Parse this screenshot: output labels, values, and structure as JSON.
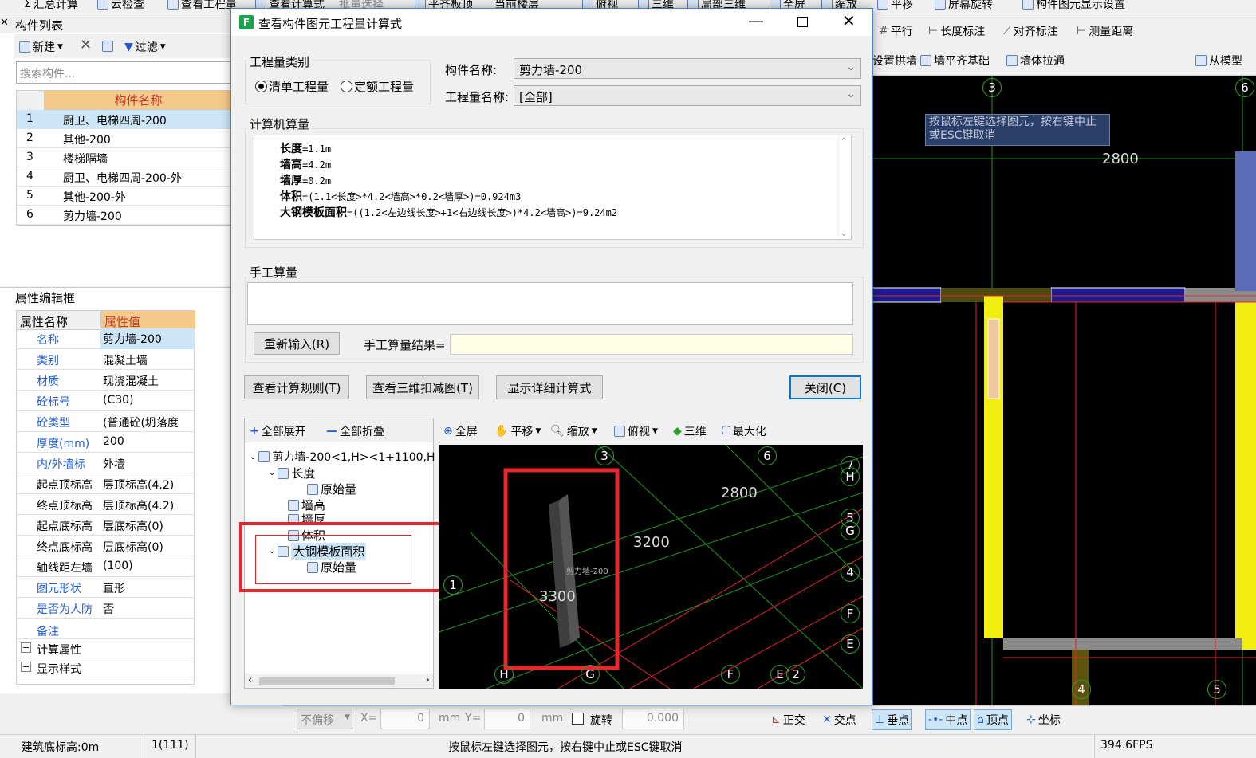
{
  "top_toolbar": {
    "items": [
      "汇总计算",
      "云检查",
      "查看工程量",
      "查看计算式",
      "批量选择",
      "平齐板顶",
      "当前楼层",
      "俯视",
      "三维",
      "局部三维",
      "全屏",
      "缩放",
      "平移",
      "屏幕旋转",
      "构件图元显示设置"
    ]
  },
  "component_list": {
    "title": "构件列表",
    "new_label": "新建",
    "filter_label": "过滤",
    "search_placeholder": "搜索构件...",
    "col_header": "构件名称",
    "rows": [
      {
        "no": "1",
        "name": "厨卫、电梯四周-200"
      },
      {
        "no": "2",
        "name": "其他-200"
      },
      {
        "no": "3",
        "name": "楼梯隔墙"
      },
      {
        "no": "4",
        "name": "厨卫、电梯四周-200-外"
      },
      {
        "no": "5",
        "name": "其他-200-外"
      },
      {
        "no": "6",
        "name": "剪力墙-200"
      }
    ]
  },
  "property_editor": {
    "title": "属性编辑框",
    "col_name": "属性名称",
    "col_value": "属性值",
    "rows": [
      {
        "name": "名称",
        "value": "剪力墙-200"
      },
      {
        "name": "类别",
        "value": "混凝土墙"
      },
      {
        "name": "材质",
        "value": "现浇混凝土"
      },
      {
        "name": "砼标号",
        "value": "(C30)"
      },
      {
        "name": "砼类型",
        "value": "(普通砼(坍落度"
      },
      {
        "name": "厚度(mm)",
        "value": "200"
      },
      {
        "name": "内/外墙标",
        "value": "外墙"
      },
      {
        "name": "起点顶标高",
        "value": "层顶标高(4.2)"
      },
      {
        "name": "终点顶标高",
        "value": "层顶标高(4.2)"
      },
      {
        "name": "起点底标高",
        "value": "层底标高(0)"
      },
      {
        "name": "终点底标高",
        "value": "层底标高(0)"
      },
      {
        "name": "轴线距左墙",
        "value": "(100)"
      },
      {
        "name": "图元形状",
        "value": "直形"
      },
      {
        "name": "是否为人防",
        "value": "否"
      },
      {
        "name": "备注",
        "value": ""
      },
      {
        "name": "计算属性",
        "value": ""
      },
      {
        "name": "显示样式",
        "value": ""
      }
    ]
  },
  "right_toolbar": {
    "row1": [
      "平行",
      "长度标注",
      "对齐标注",
      "测量距离"
    ],
    "row2": [
      "设置拱墙",
      "墙平齐基础",
      "墙体拉通",
      "从模型"
    ]
  },
  "cad_main": {
    "hint": "按鼠标左键选择图元，按右键中止或ESC键取消",
    "dim": "2800",
    "axes": [
      "3",
      "6",
      "4",
      "5"
    ]
  },
  "dialog": {
    "title": "查看构件图元工程量计算式",
    "qty_type_legend": "工程量类别",
    "radio_list": "清单工程量",
    "radio_quota": "定额工程量",
    "component_name_label": "构件名称:",
    "component_name_value": "剪力墙-200",
    "qty_name_label": "工程量名称:",
    "qty_name_value": "[全部]",
    "computer_qty_legend": "计算机算量",
    "formula": [
      {
        "k": "长度",
        "v": "=1.1m"
      },
      {
        "k": "墙高",
        "v": "=4.2m"
      },
      {
        "k": "墙厚",
        "v": "=0.2m"
      },
      {
        "k": "体积",
        "v": "=(1.1<长度>*4.2<墙高>*0.2<墙厚>)=0.924m3"
      },
      {
        "k": "大钢模板面积",
        "v": "=((1.2<左边线长度>+1<右边线长度>)*4.2<墙高>)=9.24m2"
      }
    ],
    "manual_legend": "手工算量",
    "reinput_btn": "重新输入(R)",
    "manual_result_label": "手工算量结果=",
    "btn_rules": "查看计算规则(T)",
    "btn_3d": "查看三维扣减图(T)",
    "btn_detail": "显示详细计算式",
    "btn_close": "关闭(C)",
    "tree_expand": "全部展开",
    "tree_collapse": "全部折叠",
    "tree": [
      {
        "label": "剪力墙-200<1,H><1+1100,H",
        "level": 0
      },
      {
        "label": "长度",
        "level": 1
      },
      {
        "label": "原始量",
        "level": 2
      },
      {
        "label": "墙高",
        "level": 1
      },
      {
        "label": "墙厚",
        "level": 1
      },
      {
        "label": "体积",
        "level": 1
      },
      {
        "label": "大钢模板面积",
        "level": 1
      },
      {
        "label": "原始量",
        "level": 2
      }
    ],
    "view_toolbar": [
      "全屏",
      "平移",
      "缩放",
      "俯视",
      "三维",
      "最大化"
    ],
    "preview_labels": {
      "d2800": "2800",
      "d3200": "3200",
      "d3300": "3300",
      "wall": "剪力墙-200",
      "axes": [
        "3",
        "6",
        "7",
        "H",
        "5",
        "G",
        "4",
        "F",
        "E",
        "2",
        "1",
        "H",
        "G",
        "F",
        "E"
      ]
    }
  },
  "bottom_bar": {
    "offset": "不偏移",
    "x_label": "X=",
    "x_value": "0",
    "mm1": "mm",
    "y_label": "Y=",
    "y_value": "0",
    "mm2": "mm",
    "rotate_label": "旋转",
    "rotate_value": "0.000",
    "snap": [
      "正交",
      "交点",
      "垂点",
      "中点",
      "顶点",
      "坐标"
    ]
  },
  "status_bar": {
    "elev": "建筑底标高:0m",
    "count": "1(111)",
    "hint": "按鼠标左键选择图元，按右键中止或ESC键取消",
    "fps": "394.6FPS"
  },
  "colors": {
    "highlight_red": "#e8262d",
    "cad_bg": "#000000",
    "grid_green": "#1f9a1f",
    "header_orange": "#f5c98a"
  }
}
